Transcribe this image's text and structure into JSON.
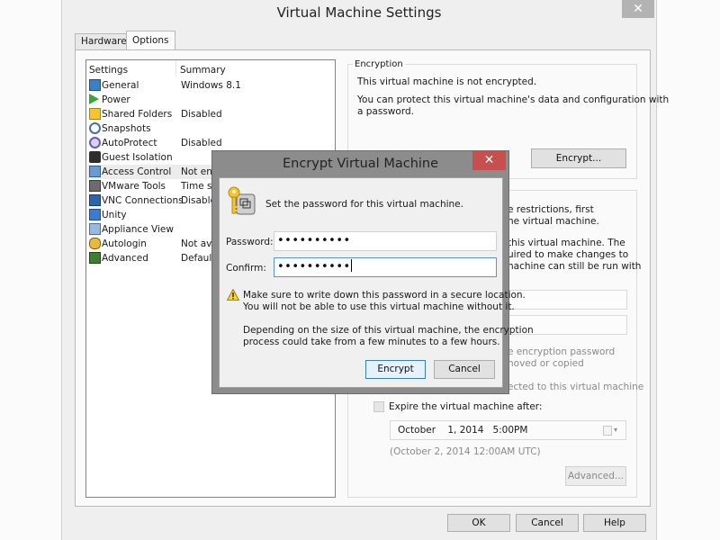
{
  "window": {
    "title": "Virtual Machine Settings",
    "close_glyph": "✕"
  },
  "tabs": [
    {
      "label": "Hardware",
      "active": false
    },
    {
      "label": "Options",
      "active": true
    }
  ],
  "settings_list": {
    "columns": [
      "Settings",
      "Summary"
    ],
    "rows": [
      {
        "label": "General",
        "summary": "Windows 8.1",
        "icon": "monitor-icon"
      },
      {
        "label": "Power",
        "summary": "",
        "icon": "play-icon"
      },
      {
        "label": "Shared Folders",
        "summary": "Disabled",
        "icon": "folder-icon"
      },
      {
        "label": "Snapshots",
        "summary": "",
        "icon": "snapshot-icon"
      },
      {
        "label": "AutoProtect",
        "summary": "Disabled",
        "icon": "autoprotect-icon"
      },
      {
        "label": "Guest Isolation",
        "summary": "",
        "icon": "lock-icon"
      },
      {
        "label": "Access Control",
        "summary": "Not enc",
        "icon": "access-control-icon",
        "selected": true
      },
      {
        "label": "VMware Tools",
        "summary": "Time sy",
        "icon": "vmware-tools-icon"
      },
      {
        "label": "VNC Connections",
        "summary": "Disablec",
        "icon": "vnc-icon"
      },
      {
        "label": "Unity",
        "summary": "",
        "icon": "unity-icon"
      },
      {
        "label": "Appliance View",
        "summary": "",
        "icon": "appliance-icon"
      },
      {
        "label": "Autologin",
        "summary": "Not ava",
        "icon": "users-icon"
      },
      {
        "label": "Advanced",
        "summary": "Default/",
        "icon": "advanced-icon"
      }
    ]
  },
  "encryption": {
    "legend": "Encryption",
    "status": "This virtual machine is not encrypted.",
    "description_line1": "You can protect this virtual machine's data and configuration with",
    "description_line2": "a password.",
    "encrypt_button": "Encrypt..."
  },
  "restrictions": {
    "line1": "e restrictions, first",
    "line2": "he virtual machine.",
    "line3": "this virtual machine. The",
    "line4": "uired to make changes to",
    "line5": "nachine can still be run with",
    "line6": "e encryption password",
    "line7": "noved or copied",
    "line8": "ected to this virtual machine",
    "expire_label": "Expire the virtual machine after:",
    "expire_checked": false,
    "date_value": "October    1, 2014   5:00PM",
    "date_utc": "(October 2, 2014 12:00AM UTC)",
    "advanced_button": "Advanced..."
  },
  "footer": {
    "ok": "OK",
    "cancel": "Cancel",
    "help": "Help"
  },
  "dialog": {
    "title": "Encrypt Virtual Machine",
    "close_glyph": "✕",
    "prompt": "Set the password for this virtual machine.",
    "password_label": "Password:",
    "password_value": "••••••••••",
    "confirm_label": "Confirm:",
    "confirm_value": "••••••••••",
    "warning_line1": "Make sure to write down this password in a secure location.",
    "warning_line2": "You will not be able to use this virtual machine without it.",
    "info_line1": "Depending on the size of this virtual machine, the encryption",
    "info_line2": "process could take from a few minutes to a few hours.",
    "encrypt_button": "Encrypt",
    "cancel_button": "Cancel"
  }
}
